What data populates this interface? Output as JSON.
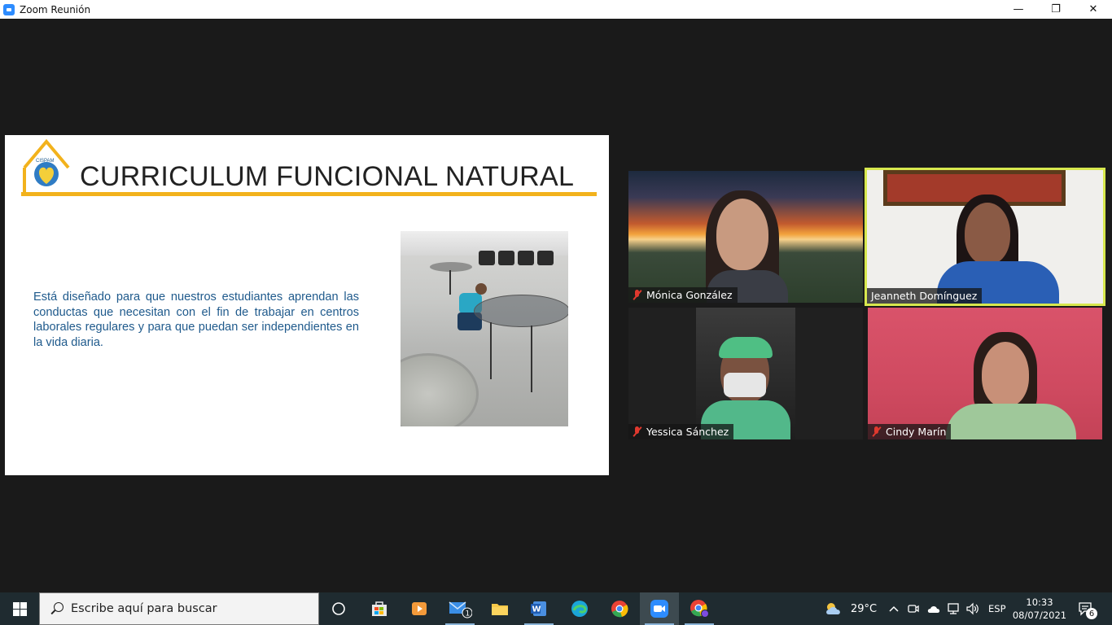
{
  "window": {
    "title": "Zoom Reunión",
    "controls": {
      "minimize": "—",
      "maximize": "❐",
      "close": "✕"
    }
  },
  "slide": {
    "title": "CURRICULUM FUNCIONAL NATURAL",
    "logo_text": "CISPAM",
    "body": "Está diseñado para que nuestros estudiantes aprendan las conductas que necesitan con el fin de trabajar en centros laborales regulares y para que puedan ser independientes en la vida diaria.",
    "accent_color": "#f2b21c",
    "text_color": "#1f5a8c"
  },
  "participants": [
    {
      "name": "Mónica González",
      "muted": true
    },
    {
      "name": "Jeanneth Domínguez",
      "muted": false,
      "active_speaker": true
    },
    {
      "name": "Yessica Sánchez",
      "muted": true
    },
    {
      "name": "Cindy Marín",
      "muted": true
    }
  ],
  "taskbar": {
    "search_placeholder": "Escribe aquí para buscar",
    "apps": [
      "task-view-icon",
      "store-icon",
      "media-player-icon",
      "mail-icon",
      "file-explorer-icon",
      "word-icon",
      "edge-icon",
      "chrome-icon",
      "zoom-icon",
      "chrome-profile-icon"
    ],
    "mail_badge": "1",
    "weather": "29°C",
    "language": "ESP",
    "time": "10:33",
    "date": "08/07/2021",
    "notifications": "6"
  }
}
